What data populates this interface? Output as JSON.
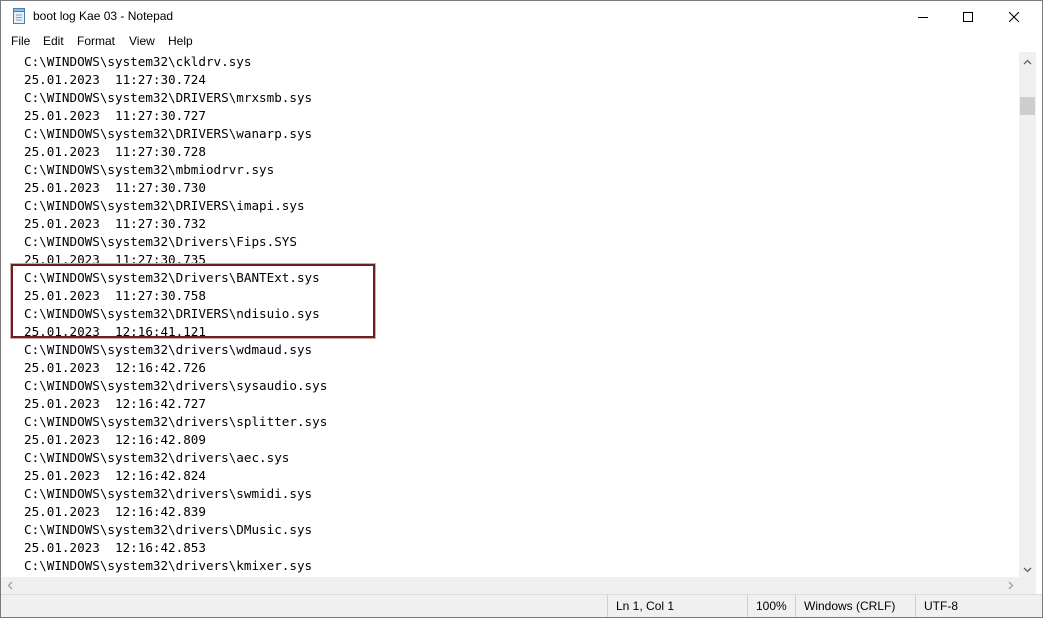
{
  "window": {
    "title": "boot log Kae 03 - Notepad",
    "icon": "notepad-icon"
  },
  "controls": {
    "minimize": "minimize-icon",
    "maximize": "maximize-icon",
    "close": "close-icon"
  },
  "menu": [
    "File",
    "Edit",
    "Format",
    "View",
    "Help"
  ],
  "editor": {
    "lines": [
      "C:\\WINDOWS\\system32\\ckldrv.sys",
      "25.01.2023  11:27:30.724",
      "C:\\WINDOWS\\system32\\DRIVERS\\mrxsmb.sys",
      "25.01.2023  11:27:30.727",
      "C:\\WINDOWS\\system32\\DRIVERS\\wanarp.sys",
      "25.01.2023  11:27:30.728",
      "C:\\WINDOWS\\system32\\mbmiodrvr.sys",
      "25.01.2023  11:27:30.730",
      "C:\\WINDOWS\\system32\\DRIVERS\\imapi.sys",
      "25.01.2023  11:27:30.732",
      "C:\\WINDOWS\\system32\\Drivers\\Fips.SYS",
      "25.01.2023  11:27:30.735",
      "C:\\WINDOWS\\system32\\Drivers\\BANTExt.sys",
      "25.01.2023  11:27:30.758",
      "C:\\WINDOWS\\system32\\DRIVERS\\ndisuio.sys",
      "25.01.2023  12:16:41.121",
      "C:\\WINDOWS\\system32\\drivers\\wdmaud.sys",
      "25.01.2023  12:16:42.726",
      "C:\\WINDOWS\\system32\\drivers\\sysaudio.sys",
      "25.01.2023  12:16:42.727",
      "C:\\WINDOWS\\system32\\drivers\\splitter.sys",
      "25.01.2023  12:16:42.809",
      "C:\\WINDOWS\\system32\\drivers\\aec.sys",
      "25.01.2023  12:16:42.824",
      "C:\\WINDOWS\\system32\\drivers\\swmidi.sys",
      "25.01.2023  12:16:42.839",
      "C:\\WINDOWS\\system32\\drivers\\DMusic.sys",
      "25.01.2023  12:16:42.853",
      "C:\\WINDOWS\\system32\\drivers\\kmixer.sys"
    ],
    "highlight_color": "#6b1f1f"
  },
  "status": {
    "position": "Ln 1, Col 1",
    "zoom": "100%",
    "line_ending": "Windows (CRLF)",
    "encoding": "UTF-8"
  }
}
